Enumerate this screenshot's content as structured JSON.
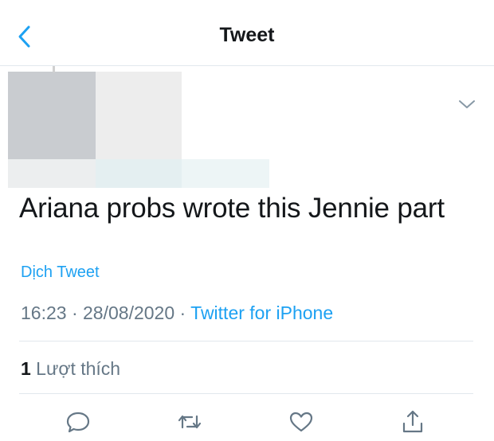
{
  "header": {
    "title": "Tweet",
    "back_icon": "chevron-left-icon"
  },
  "tweet": {
    "text": "Ariana probs wrote this Jennie part",
    "translate_label": "Dịch Tweet",
    "time": "16:23",
    "separator": " · ",
    "date": "28/08/2020",
    "source": "Twitter for iPhone",
    "like_count": "1",
    "like_label": " Lượt thích"
  },
  "actions": [
    {
      "name": "reply",
      "icon": "reply-icon"
    },
    {
      "name": "retweet",
      "icon": "retweet-icon"
    },
    {
      "name": "like",
      "icon": "heart-icon"
    },
    {
      "name": "share",
      "icon": "share-icon"
    }
  ],
  "colors": {
    "accent": "#1da1f2",
    "muted": "#657786",
    "text": "#14171a",
    "divider": "#e1e8ed"
  }
}
